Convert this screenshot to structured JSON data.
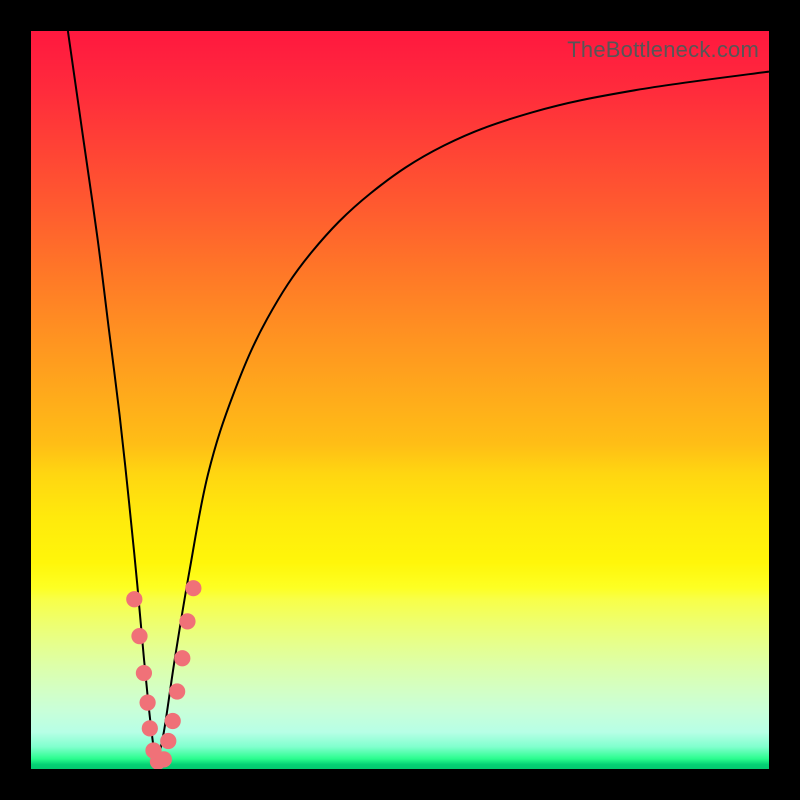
{
  "watermark": "TheBottleneck.com",
  "chart_data": {
    "type": "line",
    "title": "",
    "xlabel": "",
    "ylabel": "",
    "xlim": [
      0,
      100
    ],
    "ylim": [
      0,
      100
    ],
    "notch_x_pct": 17,
    "series": [
      {
        "name": "left-arm",
        "points_xy_pct": [
          [
            5.0,
            100.0
          ],
          [
            7.0,
            86.0
          ],
          [
            9.0,
            72.0
          ],
          [
            10.5,
            60.0
          ],
          [
            12.0,
            48.0
          ],
          [
            13.3,
            36.0
          ],
          [
            14.4,
            25.0
          ],
          [
            15.3,
            15.0
          ],
          [
            16.0,
            8.0
          ],
          [
            16.6,
            3.0
          ],
          [
            17.0,
            0.5
          ]
        ]
      },
      {
        "name": "right-arm",
        "points_xy_pct": [
          [
            17.0,
            0.5
          ],
          [
            18.0,
            5.0
          ],
          [
            19.5,
            15.0
          ],
          [
            21.5,
            27.0
          ],
          [
            24.0,
            40.0
          ],
          [
            27.5,
            51.0
          ],
          [
            32.0,
            61.0
          ],
          [
            38.0,
            70.0
          ],
          [
            46.0,
            78.0
          ],
          [
            56.0,
            84.5
          ],
          [
            68.0,
            89.0
          ],
          [
            82.0,
            92.0
          ],
          [
            100.0,
            94.5
          ]
        ]
      }
    ],
    "scatter": {
      "name": "samples",
      "points_xy_pct": [
        [
          14.0,
          23.0
        ],
        [
          14.7,
          18.0
        ],
        [
          15.3,
          13.0
        ],
        [
          15.8,
          9.0
        ],
        [
          16.1,
          5.5
        ],
        [
          16.6,
          2.5
        ],
        [
          17.2,
          1.0
        ],
        [
          18.0,
          1.3
        ],
        [
          18.6,
          3.8
        ],
        [
          19.2,
          6.5
        ],
        [
          19.8,
          10.5
        ],
        [
          20.5,
          15.0
        ],
        [
          21.2,
          20.0
        ],
        [
          22.0,
          24.5
        ]
      ],
      "radius_pct": 1.1
    },
    "gradient_stops": [
      {
        "pct": 0,
        "color": "#ff183f"
      },
      {
        "pct": 50,
        "color": "#ffbe16"
      },
      {
        "pct": 75,
        "color": "#fdff24"
      },
      {
        "pct": 100,
        "color": "#04c86f"
      }
    ]
  }
}
